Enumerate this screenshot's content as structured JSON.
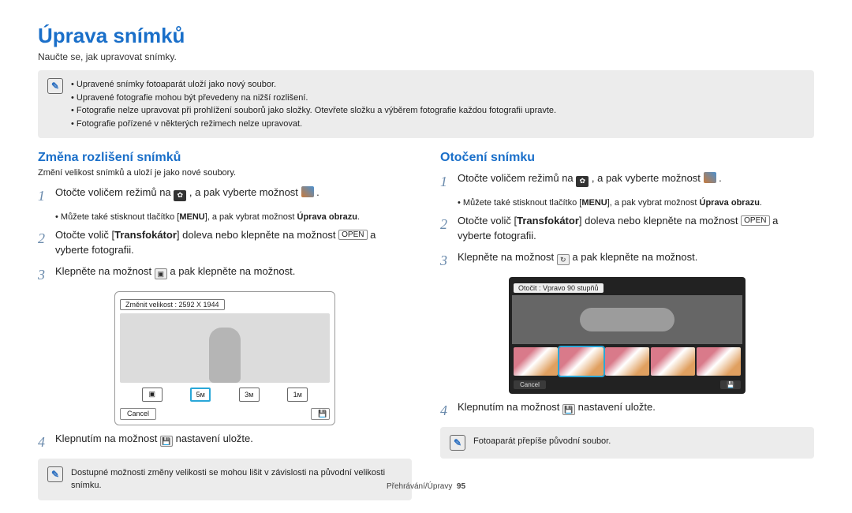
{
  "title": "Úprava snímků",
  "subtitle": "Naučte se, jak upravovat snímky.",
  "top_notes": [
    "Upravené snímky fotoaparát uloží jako nový soubor.",
    "Upravené fotografie mohou být převedeny na nižší rozlišení.",
    "Fotografie nelze upravovat při prohlížení souborů jako složky. Otevřete složku a výběrem fotografie každou fotografii upravte.",
    "Fotografie pořízené v některých režimech nelze upravovat."
  ],
  "left": {
    "heading": "Změna rozlišení snímků",
    "sub": "Změní velikost snímků a uloží je jako nové soubory.",
    "step1_a": "Otočte voličem režimů na ",
    "step1_b": ", a pak vyberte možnost ",
    "step1_c": ".",
    "step1_note_a": "Můžete také stisknout tlačítko [",
    "menu_label": "MENU",
    "step1_note_b": "], a pak vybrat možnost ",
    "step1_note_bold": "Úprava obrazu",
    "step2_a": "Otočte volič [",
    "step2_b": "] doleva nebo klepněte na možnost ",
    "step2_c": " a vyberte fotografii.",
    "open_label": "OPEN",
    "transfokator": "Transfokátor",
    "step3_a": "Klepněte na možnost ",
    "step3_b": " a pak klepněte na možnost.",
    "frame": {
      "label": "Změnit velikost : 2592 X 1944",
      "buttons": [
        "▣",
        "5м",
        "3м",
        "1м"
      ],
      "cancel": "Cancel",
      "save_icon": "save-icon"
    },
    "step4_a": "Klepnutím na možnost ",
    "step4_b": " nastavení uložte.",
    "bottom_note": "Dostupné možnosti změny velikosti se mohou lišit v závislosti na původní velikosti snímku."
  },
  "right": {
    "heading": "Otočení snímku",
    "step1_a": "Otočte voličem režimů na ",
    "step1_b": ", a pak vyberte možnost ",
    "step1_c": ".",
    "step1_note_a": "Můžete také stisknout tlačítko [",
    "menu_label": "MENU",
    "step1_note_b": "], a pak vybrat možnost ",
    "step1_note_bold": "Úprava obrazu",
    "step2_a": "Otočte volič [",
    "step2_b": "] doleva nebo klepněte na možnost ",
    "step2_c": " a vyberte fotografii.",
    "open_label": "OPEN",
    "transfokator": "Transfokátor",
    "step3_a": "Klepněte na možnost ",
    "step3_b": " a pak klepněte na možnost.",
    "frame": {
      "label": "Otočit : Vpravo 90 stupňů",
      "cancel": "Cancel",
      "save_icon": "save-icon"
    },
    "step4_a": "Klepnutím na možnost ",
    "step4_b": " nastavení uložte.",
    "bottom_note": "Fotoaparát přepíše původní soubor."
  },
  "footer_a": "Přehrávání/Úpravy",
  "footer_page": "95"
}
